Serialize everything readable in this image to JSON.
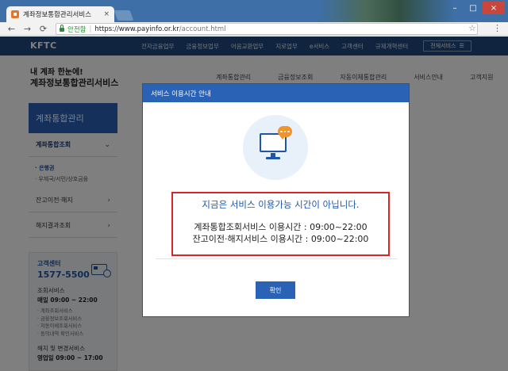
{
  "browser": {
    "tab_title": "계좌정보통합관리서비스",
    "tab_close": "×",
    "back": "←",
    "forward": "→",
    "reload": "⟳",
    "secure_label": "안전함",
    "url_host": "https://www.payinfo.or.kr",
    "url_path": "/account.html",
    "star": "☆",
    "menu": "⋮",
    "minimize": "–",
    "maximize": "□",
    "close": "×"
  },
  "site": {
    "logo": "KFTC",
    "nav": [
      "전자금융업무",
      "금융정보업무",
      "어음교환업무",
      "지로업무",
      "e서비스",
      "고객센터",
      "규제개혁센터"
    ],
    "all_services": "전체서비스",
    "all_services_icon": "☰",
    "slogan_line1": "내 계좌 한눈에!",
    "slogan_line2": "계좌정보통합관리서비스",
    "subnav": [
      "계좌통합관리",
      "금융정보조회",
      "자동이체통합관리",
      "서비스안내",
      "고객지원"
    ]
  },
  "sidebar": {
    "title": "계좌통합관리",
    "chevron": "⌄",
    "arrow": "›",
    "items": [
      {
        "label": "계좌통합조회"
      },
      {
        "label": "잔고이전·해지"
      },
      {
        "label": "해지결과조회"
      }
    ],
    "subitems": [
      "· 은행권",
      "· 우체국/서민/상호금융"
    ],
    "customer_center": {
      "label": "고객센터",
      "phone": "1577-5500",
      "inquiry_section": "조회서비스",
      "inquiry_hours": "매일 09:00 ~ 22:00",
      "inquiry_list": [
        "· 계좌조회서비스",
        "· 금융정보조회서비스",
        "· 자동이체조회서비스",
        "· 동의내역 확인서비스"
      ],
      "change_section": "해지 및 변경서비스",
      "change_hours": "영업일 09:00 ~ 17:00"
    }
  },
  "modal": {
    "title": "서비스 이용시간 안내",
    "message": "지금은 서비스 이용가능 시간이 아닙니다.",
    "time_line1": "계좌통합조회서비스 이용시간 : 09:00~22:00",
    "time_line2": "잔고이전·해지서비스 이용시간 : 09:00~22:00",
    "ok_label": "확인"
  },
  "colors": {
    "titlebar": "#3e6fa6",
    "site_nav": "#23487e",
    "primary": "#2a63b6",
    "accent_red": "#d9252a",
    "bubble_orange": "#f0942c"
  }
}
